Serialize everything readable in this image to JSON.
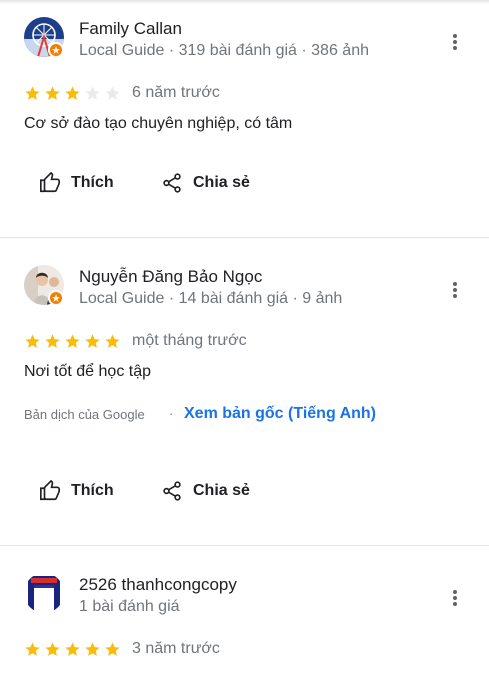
{
  "reviews": [
    {
      "name": "Family Callan",
      "meta": "Local Guide · 319 bài đánh giá · 386 ảnh",
      "rating": 3,
      "when": "6 năm trước",
      "text": "Cơ sở đào tạo chuyên nghiệp, có tâm",
      "like_label": "Thích",
      "share_label": "Chia sẻ",
      "avatar_icon": "ferris-wheel-avatar",
      "local_guide": true
    },
    {
      "name": "Nguyễn Đăng Bảo Ngọc",
      "meta": "Local Guide · 14 bài đánh giá · 9 ảnh",
      "rating": 5,
      "when": "một tháng trước",
      "text": "Nơi tốt để học tập",
      "translation_source": "Bản dịch của Google",
      "translation_separator": "·",
      "translation_link": "Xem bản gốc (Tiếng Anh)",
      "like_label": "Thích",
      "share_label": "Chia sẻ",
      "avatar_icon": "portrait-photo-avatar",
      "local_guide": true
    },
    {
      "name": "2526 thanhcongcopy",
      "meta": "1 bài đánh giá",
      "rating": 5,
      "when": "3 năm trước",
      "avatar_icon": "shop-sign-avatar",
      "local_guide": false
    }
  ],
  "colors": {
    "star_filled": "#fbbc04",
    "star_empty": "#e8eaed",
    "link": "#1a73e8",
    "local_guide_badge": "#f57c00"
  }
}
